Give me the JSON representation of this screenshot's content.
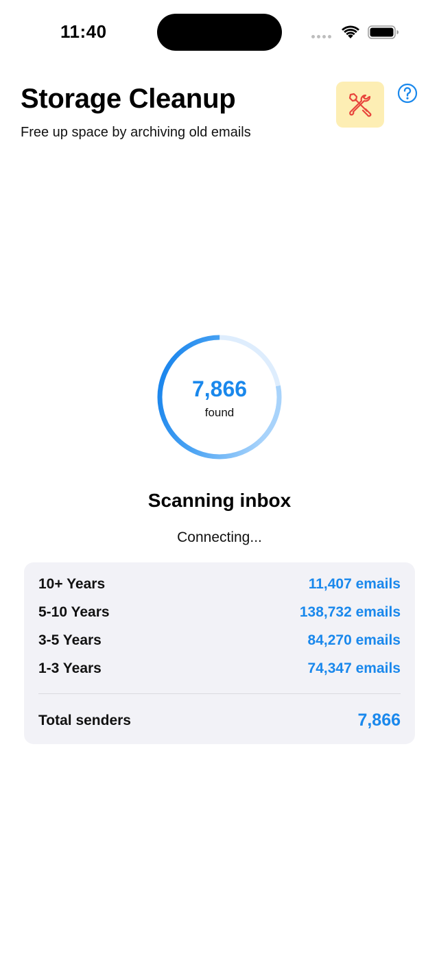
{
  "status_bar": {
    "time": "11:40"
  },
  "header": {
    "title": "Storage Cleanup",
    "subtitle": "Free up space by archiving old emails"
  },
  "icons": {
    "tools": "tools-icon",
    "help": "help-circle-icon",
    "wifi": "wifi-icon",
    "battery": "battery-icon",
    "signal": "cellular-signal-icon"
  },
  "scan": {
    "count": "7,866",
    "count_label": "found",
    "title": "Scanning inbox",
    "status": "Connecting...",
    "progress_fraction": 0.78
  },
  "stats": {
    "rows": [
      {
        "label": "10+ Years",
        "value": "11,407 emails"
      },
      {
        "label": "5-10 Years",
        "value": "138,732 emails"
      },
      {
        "label": "3-5 Years",
        "value": "84,270 emails"
      },
      {
        "label": "1-3 Years",
        "value": "74,347 emails"
      }
    ],
    "total_label": "Total senders",
    "total_value": "7,866"
  },
  "colors": {
    "accent": "#1a88ec",
    "tools_bg": "#fdeeb4",
    "tools_icon": "#e8453c",
    "card_bg": "#f2f2f7"
  }
}
